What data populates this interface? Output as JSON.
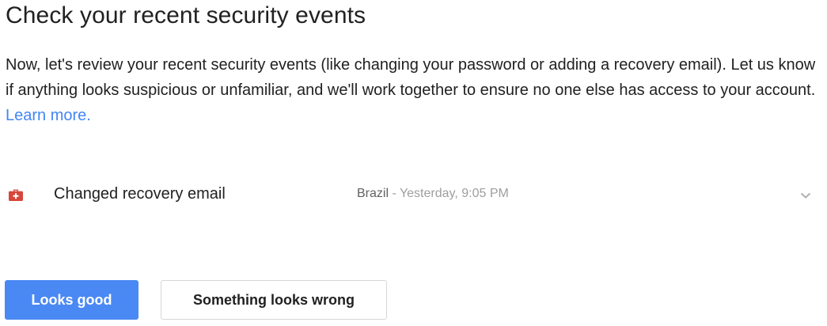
{
  "page": {
    "title": "Check your recent security events",
    "description": "Now, let's review your recent security events (like changing your password or adding a recovery email). Let us know if anything looks suspicious or unfamiliar, and we'll work together to ensure no one else has access to your account.",
    "learn_more": "Learn more."
  },
  "event": {
    "icon": "briefcase-medical-icon",
    "icon_color": "#d8453a",
    "title": "Changed recovery email",
    "location": "Brazil",
    "separator": " - ",
    "time": "Yesterday, 9:05 PM",
    "expand_icon": "chevron-down-icon"
  },
  "actions": {
    "primary_label": "Looks good",
    "secondary_label": "Something looks wrong",
    "primary_color": "#4a89f3"
  }
}
